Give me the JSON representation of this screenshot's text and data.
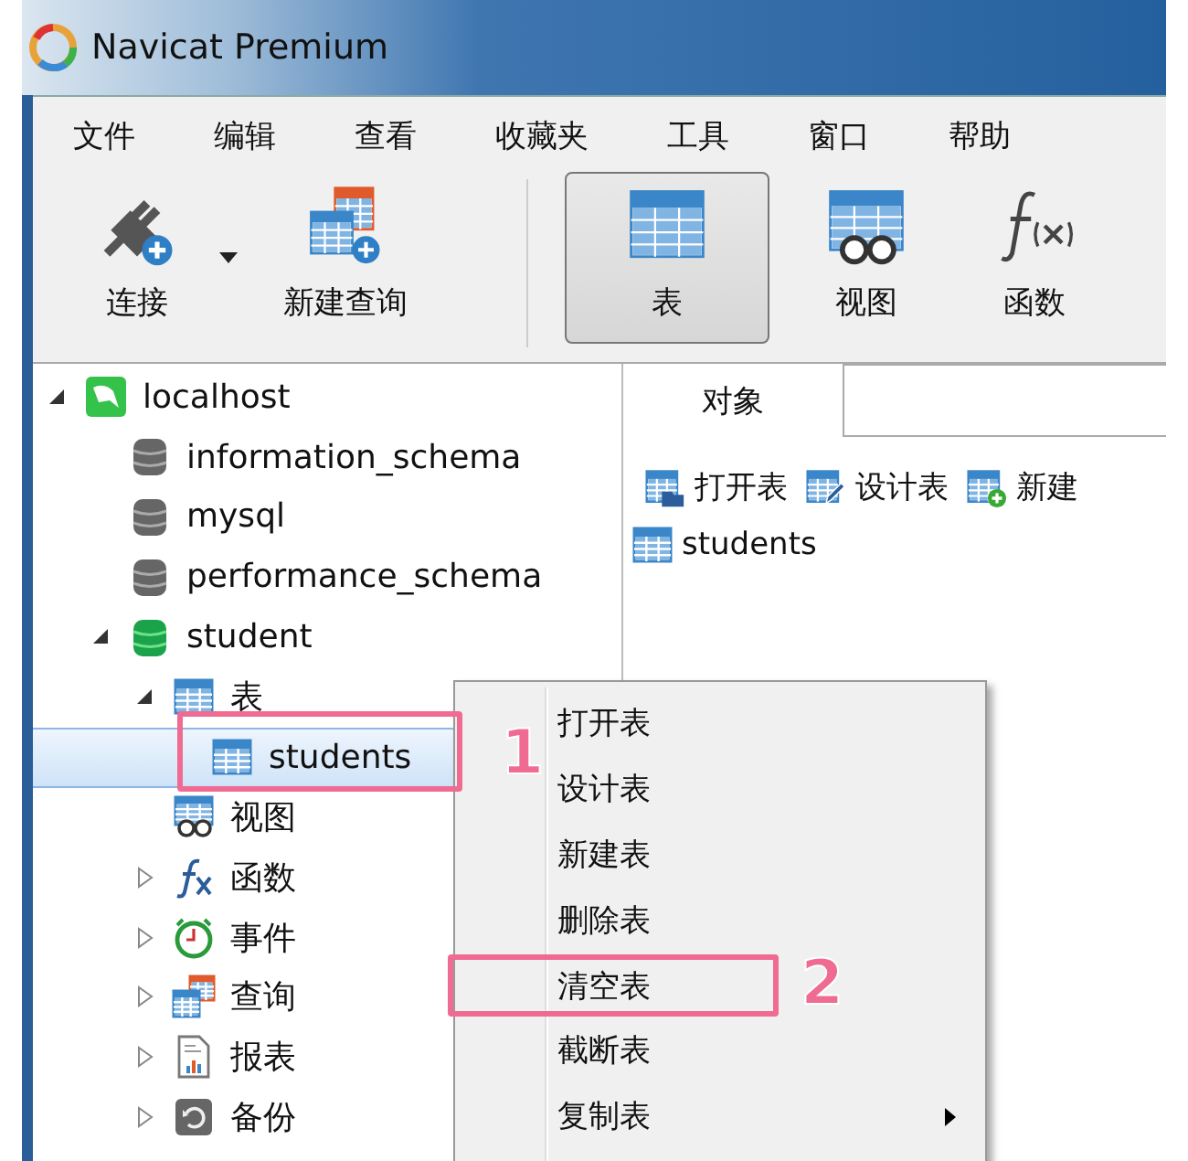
{
  "window": {
    "title": "Navicat Premium"
  },
  "menu_bar": [
    "文件",
    "编辑",
    "查看",
    "收藏夹",
    "工具",
    "窗口",
    "帮助"
  ],
  "toolbar": [
    {
      "label": "连接",
      "kind": "connect",
      "selected": false,
      "has_dropdown": true
    },
    {
      "label": "新建查询",
      "kind": "query",
      "selected": false,
      "has_dropdown": false
    },
    {
      "label": "表",
      "kind": "table",
      "selected": true,
      "has_dropdown": false
    },
    {
      "label": "视图",
      "kind": "view",
      "selected": false,
      "has_dropdown": false
    },
    {
      "label": "函数",
      "kind": "function",
      "selected": false,
      "has_dropdown": false
    }
  ],
  "tree": [
    {
      "label": "localhost",
      "kind": "server",
      "expanded": true,
      "selected": false,
      "children": [
        {
          "label": "information_schema",
          "kind": "database",
          "selected": false
        },
        {
          "label": "mysql",
          "kind": "database",
          "selected": false
        },
        {
          "label": "performance_schema",
          "kind": "database",
          "selected": false
        },
        {
          "label": "student",
          "kind": "database-open",
          "expanded": true,
          "selected": false,
          "children": [
            {
              "label": "表",
              "kind": "table",
              "expanded": true,
              "selected": false,
              "children": [
                {
                  "label": "students",
                  "kind": "table",
                  "selected": true
                }
              ]
            },
            {
              "label": "视图",
              "kind": "view",
              "selected": false
            },
            {
              "label": "函数",
              "kind": "function",
              "expanded": false,
              "selected": false
            },
            {
              "label": "事件",
              "kind": "event",
              "expanded": false,
              "selected": false
            },
            {
              "label": "查询",
              "kind": "query",
              "expanded": false,
              "selected": false
            },
            {
              "label": "报表",
              "kind": "report",
              "expanded": false,
              "selected": false
            },
            {
              "label": "备份",
              "kind": "backup",
              "expanded": false,
              "selected": false
            }
          ]
        }
      ]
    }
  ],
  "object_tabs": [
    {
      "label": "对象",
      "selected": true
    }
  ],
  "object_toolbar": [
    {
      "label": "打开表",
      "kind": "open"
    },
    {
      "label": "设计表",
      "kind": "design"
    },
    {
      "label": "新建",
      "kind": "new"
    }
  ],
  "objects": [
    {
      "label": "students",
      "kind": "table"
    }
  ],
  "context_menu": [
    {
      "label": "打开表",
      "has_submenu": false
    },
    {
      "label": "设计表",
      "has_submenu": false
    },
    {
      "label": "新建表",
      "has_submenu": false
    },
    {
      "label": "删除表",
      "has_submenu": false
    },
    {
      "label": "清空表",
      "has_submenu": false
    },
    {
      "label": "截断表",
      "has_submenu": false
    },
    {
      "label": "复制表",
      "has_submenu": true
    }
  ],
  "annotations": [
    {
      "label": "1"
    },
    {
      "label": "2"
    }
  ]
}
